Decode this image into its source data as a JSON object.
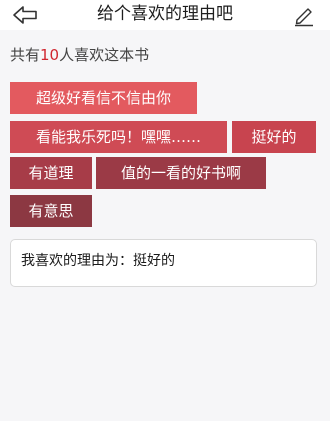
{
  "header": {
    "title": "给个喜欢的理由吧",
    "back_icon": "back-arrow-icon",
    "edit_icon": "pencil-edit-icon"
  },
  "summary": {
    "prefix": "共有",
    "count": "10",
    "suffix": "人喜欢这本书"
  },
  "tags": [
    {
      "label": "超级好看信不信由你",
      "color": "#e35a5f"
    },
    {
      "label": "看能我乐死吗！嘿嘿……",
      "color": "#cf4b55"
    },
    {
      "label": "挺好的",
      "color": "#c8444f"
    },
    {
      "label": "有道理",
      "color": "#a73c48"
    },
    {
      "label": "值的一看的好书啊",
      "color": "#9b3a46"
    },
    {
      "label": "有意思",
      "color": "#8c3842"
    }
  ],
  "reason": {
    "text": "我喜欢的理由为：挺好的"
  },
  "colors": {
    "accent": "#d0262f",
    "background": "#f6f6f8"
  }
}
